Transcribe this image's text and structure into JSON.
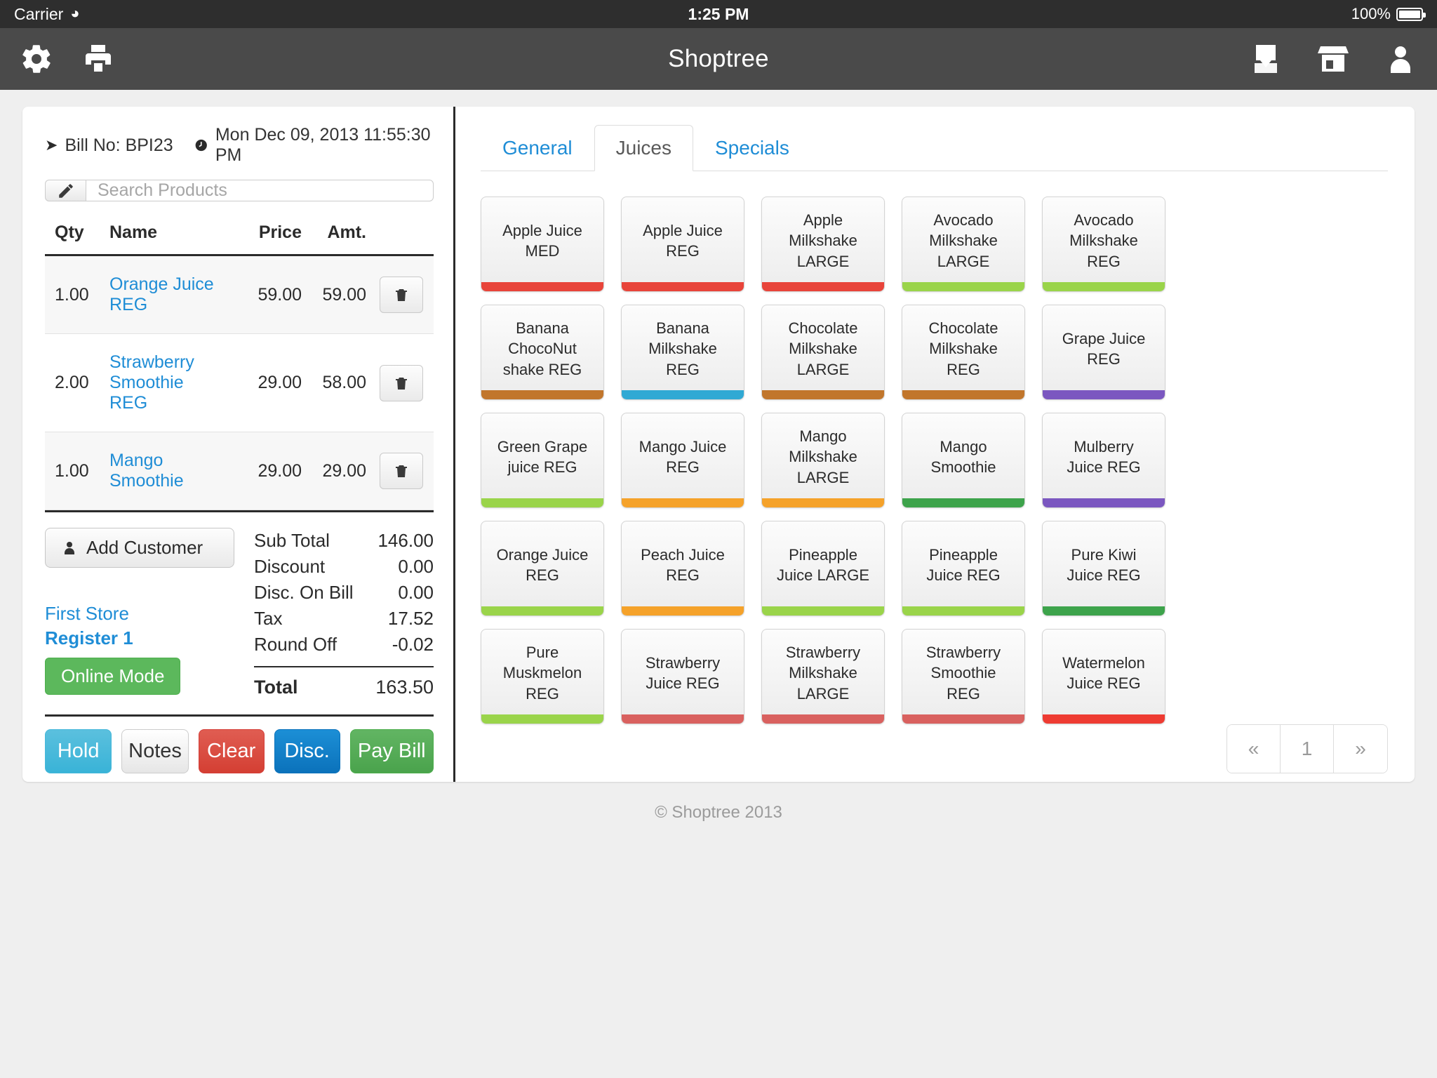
{
  "status_bar": {
    "carrier": "Carrier",
    "wifi_icon": "wifi-icon",
    "time": "1:25 PM",
    "battery_percent": "100%",
    "battery_icon": "battery-full-icon"
  },
  "navbar": {
    "title": "Shoptree",
    "settings_icon": "gear-icon",
    "print_icon": "printer-icon",
    "inbox_icon": "inbox-download-icon",
    "store_icon": "store-icon",
    "user_icon": "user-icon"
  },
  "bill": {
    "caret_icon": "chevron-right-icon",
    "bill_no": "Bill No: BPI23",
    "clock_icon": "clock-icon",
    "datetime": "Mon Dec 09, 2013 11:55:30 PM",
    "pencil_icon": "pencil-icon",
    "search_placeholder": "Search Products",
    "search_value": "",
    "columns": {
      "qty": "Qty",
      "name": "Name",
      "price": "Price",
      "amount": "Amt."
    },
    "items": [
      {
        "qty": "1.00",
        "name": "Orange Juice REG",
        "price": "59.00",
        "amount": "59.00",
        "delete_icon": "trash-icon"
      },
      {
        "qty": "2.00",
        "name": "Strawberry Smoothie REG",
        "price": "29.00",
        "amount": "58.00",
        "delete_icon": "trash-icon"
      },
      {
        "qty": "1.00",
        "name": "Mango Smoothie",
        "price": "29.00",
        "amount": "29.00",
        "delete_icon": "trash-icon"
      }
    ],
    "add_customer_label": "Add Customer",
    "add_customer_icon": "person-icon",
    "store_name": "First Store",
    "register_name": "Register 1",
    "mode_label": "Online Mode",
    "mode_color": "#5cb85c",
    "totals": [
      {
        "label": "Sub Total",
        "value": "146.00"
      },
      {
        "label": "Discount",
        "value": "0.00"
      },
      {
        "label": "Disc. On Bill",
        "value": "0.00"
      },
      {
        "label": "Tax",
        "value": "17.52"
      },
      {
        "label": "Round Off",
        "value": "-0.02"
      }
    ],
    "grand_total": {
      "label": "Total",
      "value": "163.50"
    },
    "actions": {
      "hold": "Hold",
      "notes": "Notes",
      "clear": "Clear",
      "disc": "Disc.",
      "pay": "Pay Bill"
    }
  },
  "products": {
    "tabs": [
      {
        "label": "General",
        "active": false
      },
      {
        "label": "Juices",
        "active": true
      },
      {
        "label": "Specials",
        "active": false
      }
    ],
    "items": [
      {
        "label": "Apple Juice\nMED",
        "color": "#e8443a"
      },
      {
        "label": "Apple Juice\nREG",
        "color": "#e8443a"
      },
      {
        "label": "Apple\nMilkshake\nLARGE",
        "color": "#e8443a"
      },
      {
        "label": "Avocado\nMilkshake\nLARGE",
        "color": "#9ad44a"
      },
      {
        "label": "Avocado\nMilkshake\nREG",
        "color": "#9ad44a"
      },
      {
        "label": "Banana\nChocoNut\nshake REG",
        "color": "#c1762c"
      },
      {
        "label": "Banana\nMilkshake\nREG",
        "color": "#30a9d4"
      },
      {
        "label": "Chocolate\nMilkshake\nLARGE",
        "color": "#c1762c"
      },
      {
        "label": "Chocolate\nMilkshake\nREG",
        "color": "#c1762c"
      },
      {
        "label": "Grape Juice\nREG",
        "color": "#7b57c0"
      },
      {
        "label": "Green Grape\njuice REG",
        "color": "#9ad44a"
      },
      {
        "label": "Mango Juice\nREG",
        "color": "#f5a22a"
      },
      {
        "label": "Mango\nMilkshake\nLARGE",
        "color": "#f5a22a"
      },
      {
        "label": "Mango\nSmoothie",
        "color": "#3da34b"
      },
      {
        "label": "Mulberry\nJuice REG",
        "color": "#7b57c0"
      },
      {
        "label": "Orange Juice\nREG",
        "color": "#9ad44a"
      },
      {
        "label": "Peach Juice\nREG",
        "color": "#f5a22a"
      },
      {
        "label": "Pineapple\nJuice LARGE",
        "color": "#9ad44a"
      },
      {
        "label": "Pineapple\nJuice REG",
        "color": "#9ad44a"
      },
      {
        "label": "Pure Kiwi\nJuice REG",
        "color": "#3da34b"
      },
      {
        "label": "Pure\nMuskmelon\nREG",
        "color": "#9ad44a"
      },
      {
        "label": "Strawberry\nJuice REG",
        "color": "#d9615f"
      },
      {
        "label": "Strawberry\nMilkshake\nLARGE",
        "color": "#d9615f"
      },
      {
        "label": "Strawberry\nSmoothie\nREG",
        "color": "#d9615f"
      },
      {
        "label": "Watermelon\nJuice REG",
        "color": "#ee3b32"
      }
    ],
    "pagination": {
      "prev": "«",
      "current": "1",
      "next": "»"
    }
  },
  "footer": {
    "copyright": "© Shoptree 2013"
  }
}
